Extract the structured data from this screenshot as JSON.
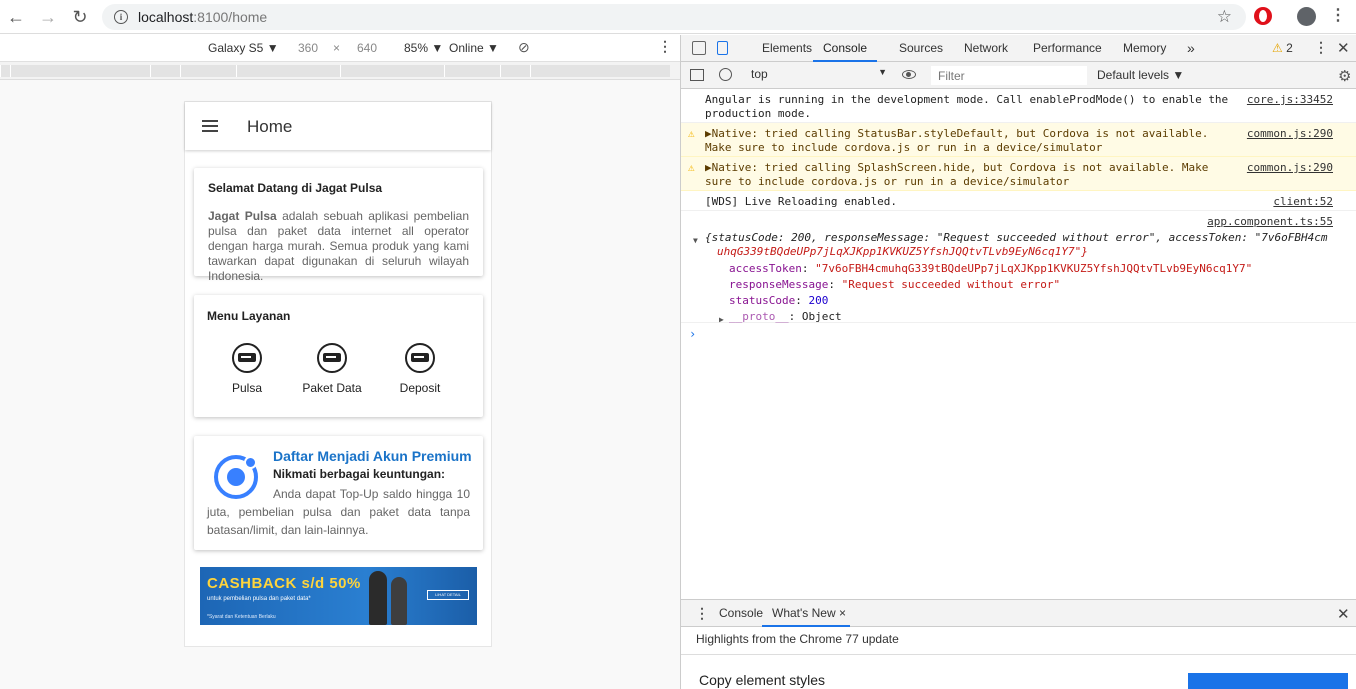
{
  "browser": {
    "url_host": "localhost",
    "url_rest": ":8100/home",
    "icons": [
      "back-arrow-icon",
      "forward-arrow-icon",
      "reload-icon",
      "info-icon",
      "star-icon",
      "opera-icon",
      "profile-icon",
      "kebab-icon"
    ]
  },
  "device_toolbar": {
    "device": "Galaxy S5 ▼",
    "width": "360",
    "times": "×",
    "height": "640",
    "zoom": "85% ▼",
    "network": "Online ▼"
  },
  "app": {
    "title": "Home",
    "welcome_card": {
      "title": "Selamat Datang di Jagat Pulsa",
      "bold_lead": "Jagat Pulsa",
      "body": " adalah sebuah aplikasi pembelian pulsa dan paket data internet all operator dengan harga murah. Semua produk yang kami tawarkan dapat digunakan di seluruh wilayah Indonesia."
    },
    "menu_card": {
      "title": "Menu Layanan",
      "items": [
        {
          "label": "Pulsa"
        },
        {
          "label": "Paket Data"
        },
        {
          "label": "Deposit"
        }
      ]
    },
    "premium_card": {
      "title": "Daftar Menjadi Akun Premium",
      "subtitle": "Nikmati berbagai keuntungan:",
      "body": "Anda dapat Top-Up saldo hingga 10 juta, pembelian pulsa dan paket data tanpa batasan/limit, dan lain-lainnya."
    },
    "banner": {
      "headline": "CASHBACK s/d 50%",
      "subline": "untuk pembelian pulsa dan paket data*",
      "fine_print": "*Syarat dan Ketentuan Berlaku",
      "button": "LIHAT DETAIL"
    }
  },
  "devtools": {
    "tabs": [
      "Elements",
      "Console",
      "Sources",
      "Network",
      "Performance",
      "Memory",
      "»"
    ],
    "active_tab": "Console",
    "warning_count": "2",
    "context": "top",
    "filter_placeholder": "Filter",
    "levels": "Default levels ▼",
    "messages": [
      {
        "type": "log",
        "text": "Angular is running in the development mode. Call enableProdMode() to enable the production mode.",
        "source": "core.js:33452"
      },
      {
        "type": "warn",
        "text": "▶Native: tried calling StatusBar.styleDefault, but Cordova is not available. Make sure to include cordova.js or run in a device/simulator",
        "source": "common.js:290"
      },
      {
        "type": "warn",
        "text": "▶Native: tried calling SplashScreen.hide, but Cordova is not available. Make sure to include cordova.js or run in a device/simulator",
        "source": "common.js:290"
      },
      {
        "type": "log",
        "text": "[WDS] Live Reloading enabled.",
        "source": "client:52"
      }
    ],
    "object_log": {
      "source": "app.component.ts:55",
      "summary_1": "{statusCode: 200, responseMessage: \"Request succeeded without error\", accessToken: \"7v6oFBH4cm",
      "summary_2": "uhqG339tBQdeUPp7jLqXJKpp1KVKUZ5YfshJQQtvTLvb9EyN6cq1Y7\"}",
      "access_token_key": "accessToken",
      "access_token_val": "\"7v6oFBH4cmuhqG339tBQdeUPp7jLqXJKpp1KVKUZ5YfshJQQtvTLvb9EyN6cq1Y7\"",
      "response_key": "responseMessage",
      "response_val": "\"Request succeeded without error\"",
      "status_key": "statusCode",
      "status_val": "200",
      "proto_key": "__proto__",
      "proto_val": "Object"
    },
    "drawer": {
      "tabs": [
        "Console",
        "What's New ×"
      ],
      "active": "What's New ×",
      "highlights": "Highlights from the Chrome 77 update",
      "feature": "Copy element styles"
    }
  }
}
